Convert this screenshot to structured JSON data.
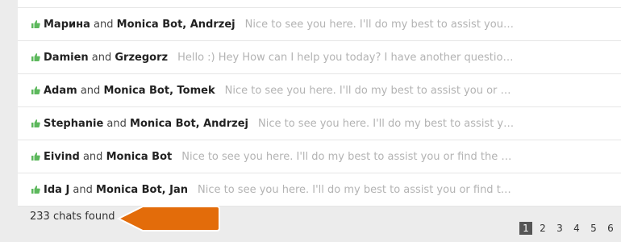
{
  "chats": [
    {
      "first": "",
      "second": "",
      "preview": ""
    },
    {
      "first": "Марина",
      "second": "Monica Bot, Andrzej",
      "preview": "Nice to see you here. I'll do my best to assist you or find the best agent for you."
    },
    {
      "first": "Damien",
      "second": "Grzegorz",
      "preview": "Hello :) Hey How can I help you today? I have another question for you today"
    },
    {
      "first": "Adam",
      "second": "Monica Bot, Tomek",
      "preview": "Nice to see you here. I'll do my best to assist you or find the best agent for you."
    },
    {
      "first": "Stephanie",
      "second": "Monica Bot, Andrzej",
      "preview": "Nice to see you here. I'll do my best to assist you or find the best agent for you."
    },
    {
      "first": "Eivind",
      "second": "Monica Bot",
      "preview": "Nice to see you here. I'll do my best to assist you or find the best agent for you."
    },
    {
      "first": "Ida J",
      "second": "Monica Bot, Jan",
      "preview": "Nice to see you here. I'll do my best to assist you or find the best agent for you."
    }
  ],
  "connector": "and",
  "summary": {
    "found_text": "233 chats found"
  },
  "pagination": {
    "pages": [
      "1",
      "2",
      "3",
      "4",
      "5",
      "6"
    ],
    "active": "1"
  },
  "colors": {
    "thumb": "#5cb85c",
    "arrow": "#e36c0a",
    "active_page": "#555555"
  },
  "icons": {
    "rating": "thumbs-up-icon",
    "pointer": "arrow-pointer-icon"
  }
}
